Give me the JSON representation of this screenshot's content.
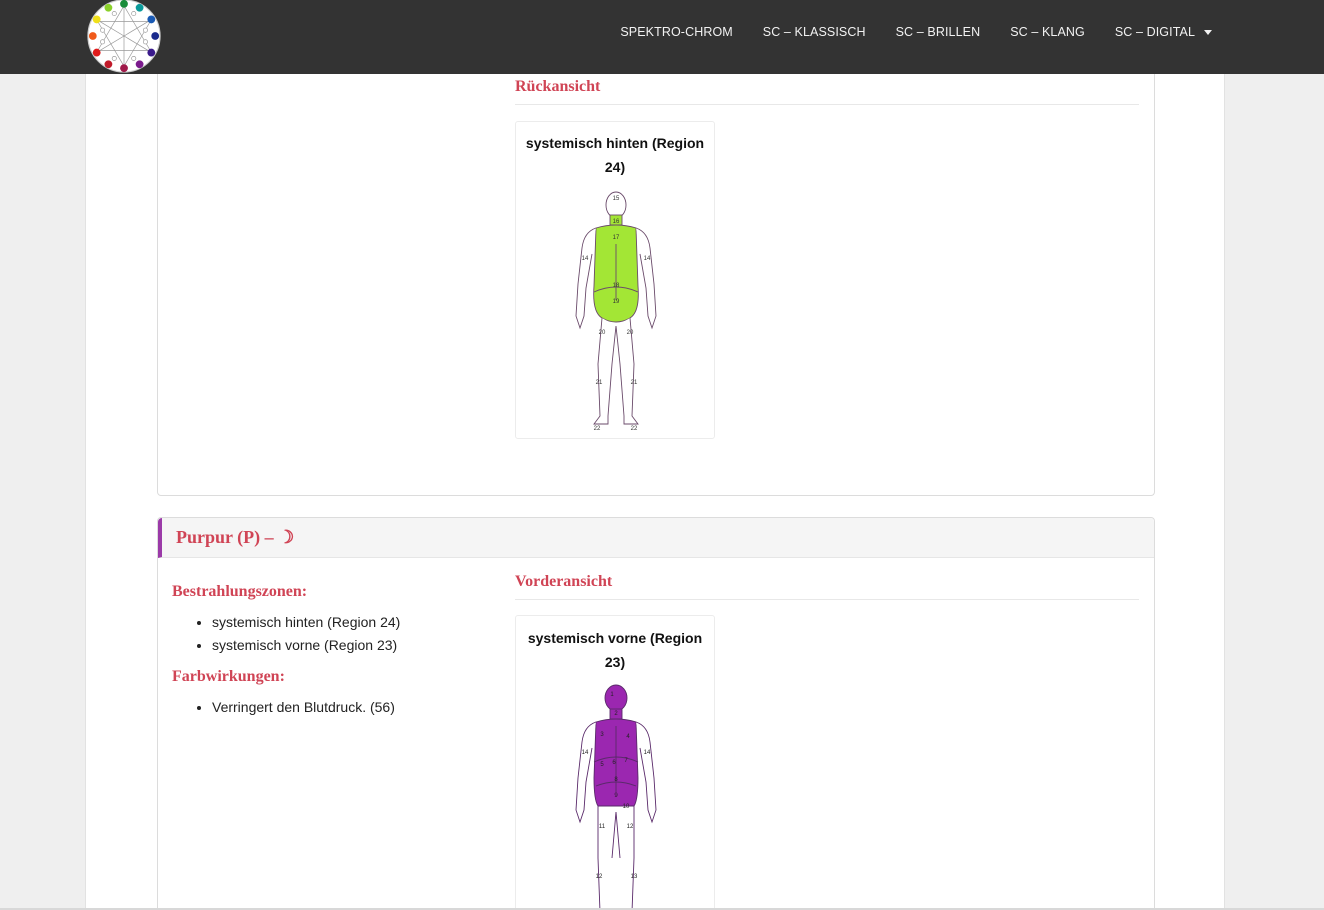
{
  "nav": {
    "items": [
      "SPEKTRO-CHROM",
      "SC – KLASSISCH",
      "SC – BRILLEN",
      "SC – KLANG",
      "SC – DIGITAL"
    ]
  },
  "section1": {
    "heading": "Rückansicht",
    "card_title": "systemisch hinten (Region 24)",
    "fill_color": "#a3e635",
    "labels": [
      "15",
      "16",
      "17",
      "14",
      "14",
      "18",
      "19",
      "20",
      "20",
      "21",
      "21",
      "22",
      "22"
    ]
  },
  "section2": {
    "title": "Purpur (P) – ☽",
    "zones_heading": "Bestrahlungszonen:",
    "zones": [
      "systemisch hinten (Region 24)",
      "systemisch vorne (Region 23)"
    ],
    "effects_heading": "Farbwirkungen:",
    "effects": [
      "Verringert den Blutdruck. (56)"
    ],
    "view_heading": "Vorderansicht",
    "card_title": "systemisch vorne (Region 23)",
    "fill_color": "#9b27b0",
    "labels": [
      "1",
      "2",
      "3",
      "4",
      "14",
      "14",
      "5",
      "6",
      "7",
      "8",
      "9",
      "10",
      "11",
      "12",
      "12",
      "13",
      "13"
    ]
  },
  "colors": {
    "navbar": "#333333",
    "accent_red": "#d04455",
    "accent_purple": "#9b3aa8"
  }
}
